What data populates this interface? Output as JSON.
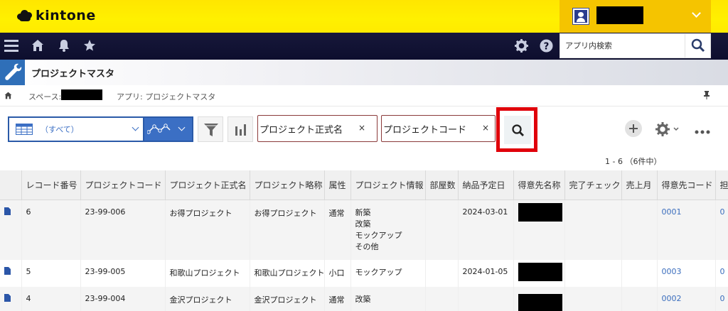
{
  "brand": {
    "name": "kintone"
  },
  "nav": {
    "search_placeholder": "アプリ内検索"
  },
  "app": {
    "title": "プロジェクトマスタ"
  },
  "breadcrumb": {
    "space_label": "スペース:",
    "app_label": "アプリ: プロジェクトマスタ"
  },
  "toolbar": {
    "view_label": "（すべて）",
    "filter1": "プロジェクト正式名",
    "filter2": "プロジェクトコード",
    "clear": "×",
    "count": "1 - 6 （6件中）"
  },
  "table": {
    "headers": [
      "",
      "レコード番号",
      "プロジェクトコード",
      "プロジェクト正式名",
      "プロジェクト略称",
      "属性",
      "プロジェクト情報",
      "部屋数",
      "納品予定日",
      "得意先名称",
      "完了チェック",
      "売上月",
      "得意先コード",
      "担"
    ],
    "rows": [
      {
        "no": "6",
        "code": "23-99-006",
        "name": "お得プロジェクト",
        "short": "お得プロジェクト",
        "attr": "通常",
        "info": [
          "新築",
          "改築",
          "モックアップ",
          "その他"
        ],
        "rooms": "",
        "date": "2024-03-01",
        "client_code": "0001",
        "last": "0"
      },
      {
        "no": "5",
        "code": "23-99-005",
        "name": "和歌山プロジェクト",
        "short": "和歌山プロジェクト",
        "attr": "小口",
        "info": [
          "モックアップ"
        ],
        "rooms": "",
        "date": "2024-01-05",
        "client_code": "0003",
        "last": "0"
      },
      {
        "no": "4",
        "code": "23-99-004",
        "name": "金沢プロジェクト",
        "short": "金沢プロジェクト",
        "attr": "通常",
        "info": [
          "改築"
        ],
        "rooms": "",
        "date": "",
        "client_code": "0002",
        "last": "0"
      }
    ]
  },
  "colors": {
    "brand_yellow": "#ffe600",
    "nav_dark": "#0d0e2e",
    "accent_blue": "#3b6fc4",
    "highlight_red": "#e0000a"
  }
}
